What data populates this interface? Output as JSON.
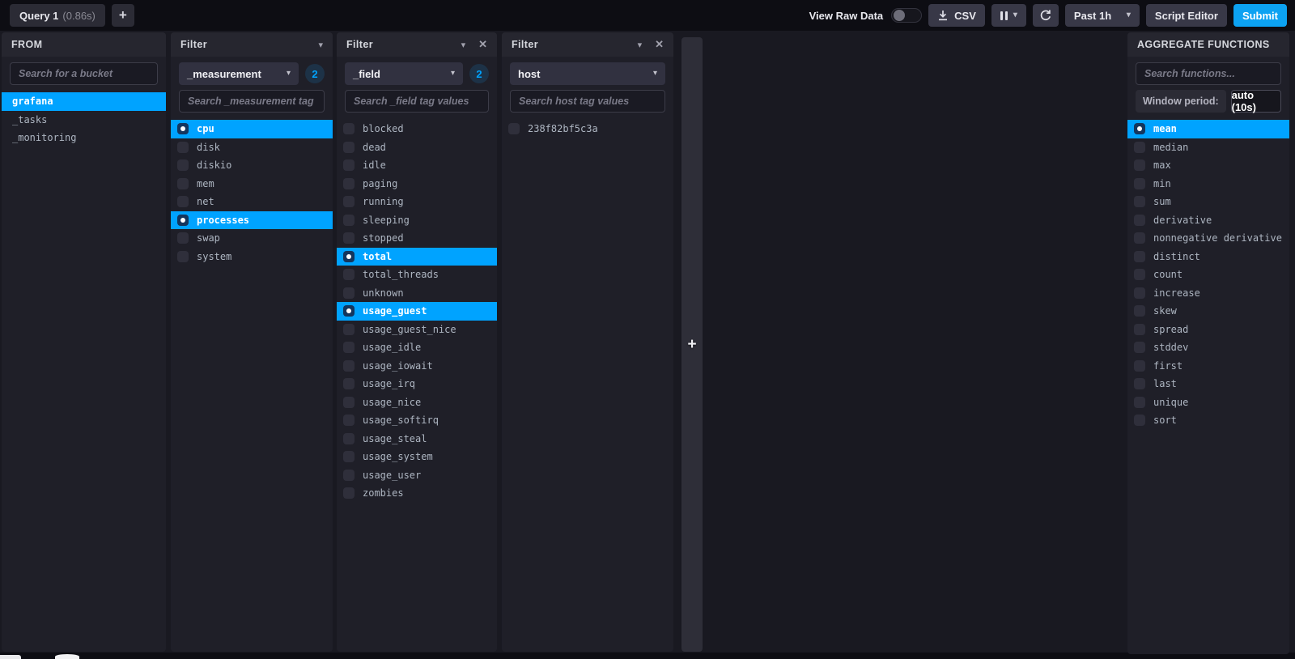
{
  "icons": {
    "caret_down": "▾",
    "close": "✕",
    "plus": "+",
    "add_filter": "+"
  },
  "topbar": {
    "query_tab": {
      "label": "Query 1",
      "duration": "(0.86s)"
    },
    "view_raw_data_label": "View Raw Data",
    "csv_label": "CSV",
    "time_range_label": "Past 1h",
    "script_editor_label": "Script Editor",
    "submit_label": "Submit"
  },
  "from_panel": {
    "title": "FROM",
    "search_placeholder": "Search for a bucket",
    "buckets": [
      {
        "label": "grafana",
        "checked": true
      },
      {
        "label": "_tasks",
        "checked": false
      },
      {
        "label": "_monitoring",
        "checked": false
      }
    ]
  },
  "filters": [
    {
      "title": "Filter",
      "key": "_measurement",
      "badge": "2",
      "search_placeholder": "Search _measurement tag values",
      "items": [
        {
          "label": "cpu",
          "checked": true
        },
        {
          "label": "disk",
          "checked": false
        },
        {
          "label": "diskio",
          "checked": false
        },
        {
          "label": "mem",
          "checked": false
        },
        {
          "label": "net",
          "checked": false
        },
        {
          "label": "processes",
          "checked": true
        },
        {
          "label": "swap",
          "checked": false
        },
        {
          "label": "system",
          "checked": false
        }
      ]
    },
    {
      "title": "Filter",
      "key": "_field",
      "badge": "2",
      "search_placeholder": "Search _field tag values",
      "items": [
        {
          "label": "blocked",
          "checked": false
        },
        {
          "label": "dead",
          "checked": false
        },
        {
          "label": "idle",
          "checked": false
        },
        {
          "label": "paging",
          "checked": false
        },
        {
          "label": "running",
          "checked": false
        },
        {
          "label": "sleeping",
          "checked": false
        },
        {
          "label": "stopped",
          "checked": false
        },
        {
          "label": "total",
          "checked": true
        },
        {
          "label": "total_threads",
          "checked": false
        },
        {
          "label": "unknown",
          "checked": false
        },
        {
          "label": "usage_guest",
          "checked": true
        },
        {
          "label": "usage_guest_nice",
          "checked": false
        },
        {
          "label": "usage_idle",
          "checked": false
        },
        {
          "label": "usage_iowait",
          "checked": false
        },
        {
          "label": "usage_irq",
          "checked": false
        },
        {
          "label": "usage_nice",
          "checked": false
        },
        {
          "label": "usage_softirq",
          "checked": false
        },
        {
          "label": "usage_steal",
          "checked": false
        },
        {
          "label": "usage_system",
          "checked": false
        },
        {
          "label": "usage_user",
          "checked": false
        },
        {
          "label": "zombies",
          "checked": false
        }
      ]
    },
    {
      "title": "Filter",
      "key": "host",
      "search_placeholder": "Search host tag values",
      "items": [
        {
          "label": "238f82bf5c3a",
          "checked": false
        }
      ]
    }
  ],
  "aggregate_panel": {
    "title": "AGGREGATE FUNCTIONS",
    "search_placeholder": "Search functions...",
    "window_period_label": "Window period:",
    "window_period_value": "auto (10s)",
    "functions": [
      {
        "label": "mean",
        "checked": true
      },
      {
        "label": "median",
        "checked": false
      },
      {
        "label": "max",
        "checked": false
      },
      {
        "label": "min",
        "checked": false
      },
      {
        "label": "sum",
        "checked": false
      },
      {
        "label": "derivative",
        "checked": false
      },
      {
        "label": "nonnegative derivative",
        "checked": false
      },
      {
        "label": "distinct",
        "checked": false
      },
      {
        "label": "count",
        "checked": false
      },
      {
        "label": "increase",
        "checked": false
      },
      {
        "label": "skew",
        "checked": false
      },
      {
        "label": "spread",
        "checked": false
      },
      {
        "label": "stddev",
        "checked": false
      },
      {
        "label": "first",
        "checked": false
      },
      {
        "label": "last",
        "checked": false
      },
      {
        "label": "unique",
        "checked": false
      },
      {
        "label": "sort",
        "checked": false
      }
    ]
  }
}
